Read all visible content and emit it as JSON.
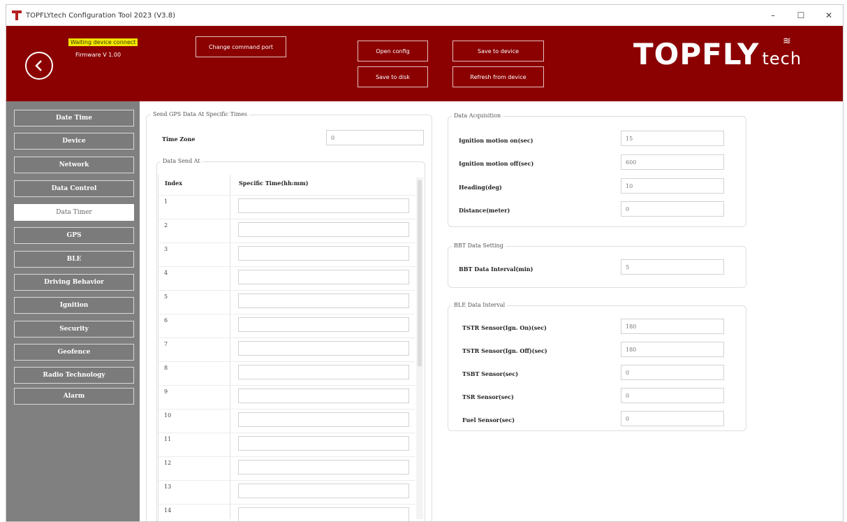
{
  "window": {
    "title": "TOPFLYtech Configuration Tool 2023 (V3.8)",
    "controls": {
      "minimize": "–",
      "maximize": "☐",
      "close": "✕"
    }
  },
  "header": {
    "status_warning": "Waiting device connect",
    "status_version": "Firmware V 1.00",
    "buttons": {
      "change_comm_port": "Change command port",
      "open_config": "Open config",
      "save_to_device": "Save to device",
      "save_to_disk": "Save to disk",
      "refresh_from_device": "Refresh from device"
    },
    "logo": {
      "brand": "TOPFLY",
      "suffix": "tech"
    },
    "colors": {
      "header_bg": "#8b0000",
      "warning_bg": "#f2e600",
      "sidebar_bg": "#808080"
    }
  },
  "sidebar": {
    "items": [
      {
        "label": "Date Time"
      },
      {
        "label": "Device"
      },
      {
        "label": "Network"
      },
      {
        "label": "Data Control"
      },
      {
        "label": "Data Timer"
      },
      {
        "label": "GPS"
      },
      {
        "label": "BLE"
      },
      {
        "label": "Driving Behavior"
      },
      {
        "label": "Ignition"
      },
      {
        "label": "Security"
      },
      {
        "label": "Geofence"
      },
      {
        "label": "Radio Technology"
      },
      {
        "label": "Alarm"
      }
    ],
    "active_index": 4
  },
  "send_gps": {
    "title": "Send GPS Data At Specific Times",
    "time_zone_label": "Time Zone",
    "time_zone_value": "0",
    "data_send_title": "Data Send At",
    "col_index": "Index",
    "col_time": "Specific Time(hh:mm)",
    "rows": [
      "1",
      "2",
      "3",
      "4",
      "5",
      "6",
      "7",
      "8",
      "9",
      "10",
      "11",
      "12",
      "13",
      "14"
    ]
  },
  "data_acquisition": {
    "title": "Data Acquisition",
    "fields": [
      {
        "label": "Ignition motion on(sec)",
        "value": "15"
      },
      {
        "label": "Ignition motion off(sec)",
        "value": "600"
      },
      {
        "label": "Heading(deg)",
        "value": "10"
      },
      {
        "label": "Distance(meter)",
        "value": "0"
      }
    ]
  },
  "bbt_data": {
    "title": "BBT Data Setting",
    "fields": [
      {
        "label": "BBT Data Interval(min)",
        "value": "5"
      }
    ]
  },
  "ble_data": {
    "title": "BLE Data Interval",
    "fields": [
      {
        "label": "TSTR Sensor(Ign. On)(sec)",
        "value": "180"
      },
      {
        "label": "TSTR Sensor(Ign. Off)(sec)",
        "value": "180"
      },
      {
        "label": "TSBT Sensor(sec)",
        "value": "0"
      },
      {
        "label": "TSR Sensor(sec)",
        "value": "0"
      },
      {
        "label": "Fuel Sensor(sec)",
        "value": "0"
      }
    ]
  }
}
